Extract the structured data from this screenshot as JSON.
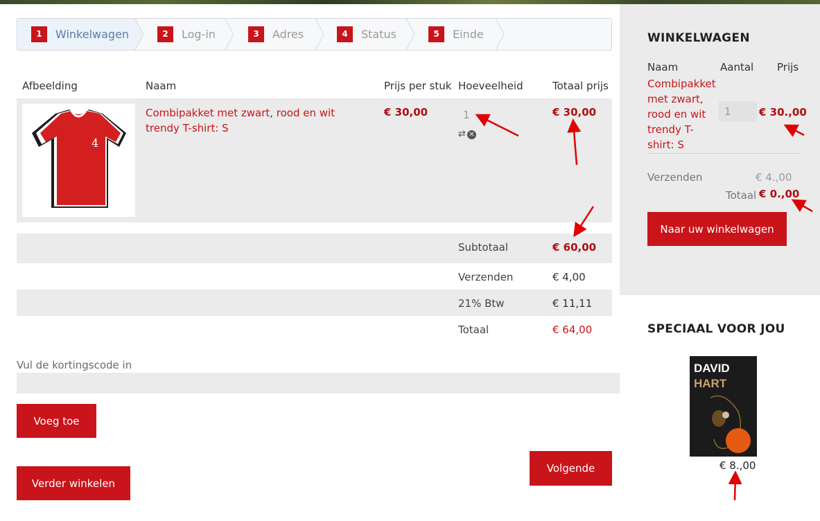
{
  "steps": [
    {
      "num": "1",
      "label": "Winkelwagen",
      "active": true
    },
    {
      "num": "2",
      "label": "Log-in"
    },
    {
      "num": "3",
      "label": "Adres"
    },
    {
      "num": "4",
      "label": "Status"
    },
    {
      "num": "5",
      "label": "Einde"
    }
  ],
  "cart": {
    "headers": {
      "image": "Afbeelding",
      "name": "Naam",
      "unit_price": "Prijs per stuk",
      "quantity": "Hoeveelheid",
      "total_price": "Totaal prijs"
    },
    "item": {
      "image_text": "4",
      "name": "Combipakket met zwart, rood en wit trendy T-shirt: S",
      "unit_price": "€ 30,00",
      "quantity": "1",
      "total": "€ 30,00",
      "update_icon": "refresh-icon",
      "remove_icon": "remove-icon"
    },
    "summary": {
      "subtotal_label": "Subtotaal",
      "subtotal_value": "€ 60,00",
      "shipping_label": "Verzenden",
      "shipping_value": "€ 4,00",
      "vat_label": "21% Btw",
      "vat_value": "€ 11,11",
      "total_label": "Totaal",
      "total_value": "€ 64,00"
    }
  },
  "coupon": {
    "label": "Vul de kortingscode in",
    "value": "",
    "add_button": "Voeg toe"
  },
  "buttons": {
    "next": "Volgende",
    "continue_shopping": "Verder winkelen"
  },
  "sidebar": {
    "title": "WINKELWAGEN",
    "col_name": "Naam",
    "col_qty": "Aantal",
    "col_price": "Prijs",
    "item_name": "Combipakket met zwart, rood en wit trendy T-shirt: S",
    "item_qty": "1",
    "item_price": "€ 30.,00",
    "shipping_label": "Verzenden",
    "shipping_value": "€ 4.,00",
    "total_label": "Totaal",
    "total_value": "€ 0.,00",
    "cart_button": "Naar uw winkelwagen"
  },
  "special": {
    "title": "SPECIAAL VOOR JOU",
    "book_title_1": "DAVID",
    "book_title_2": "HART",
    "price": "€ 8.,00"
  },
  "colors": {
    "accent": "#c8141a",
    "price": "#b00d12",
    "panel": "#ebebeb"
  }
}
